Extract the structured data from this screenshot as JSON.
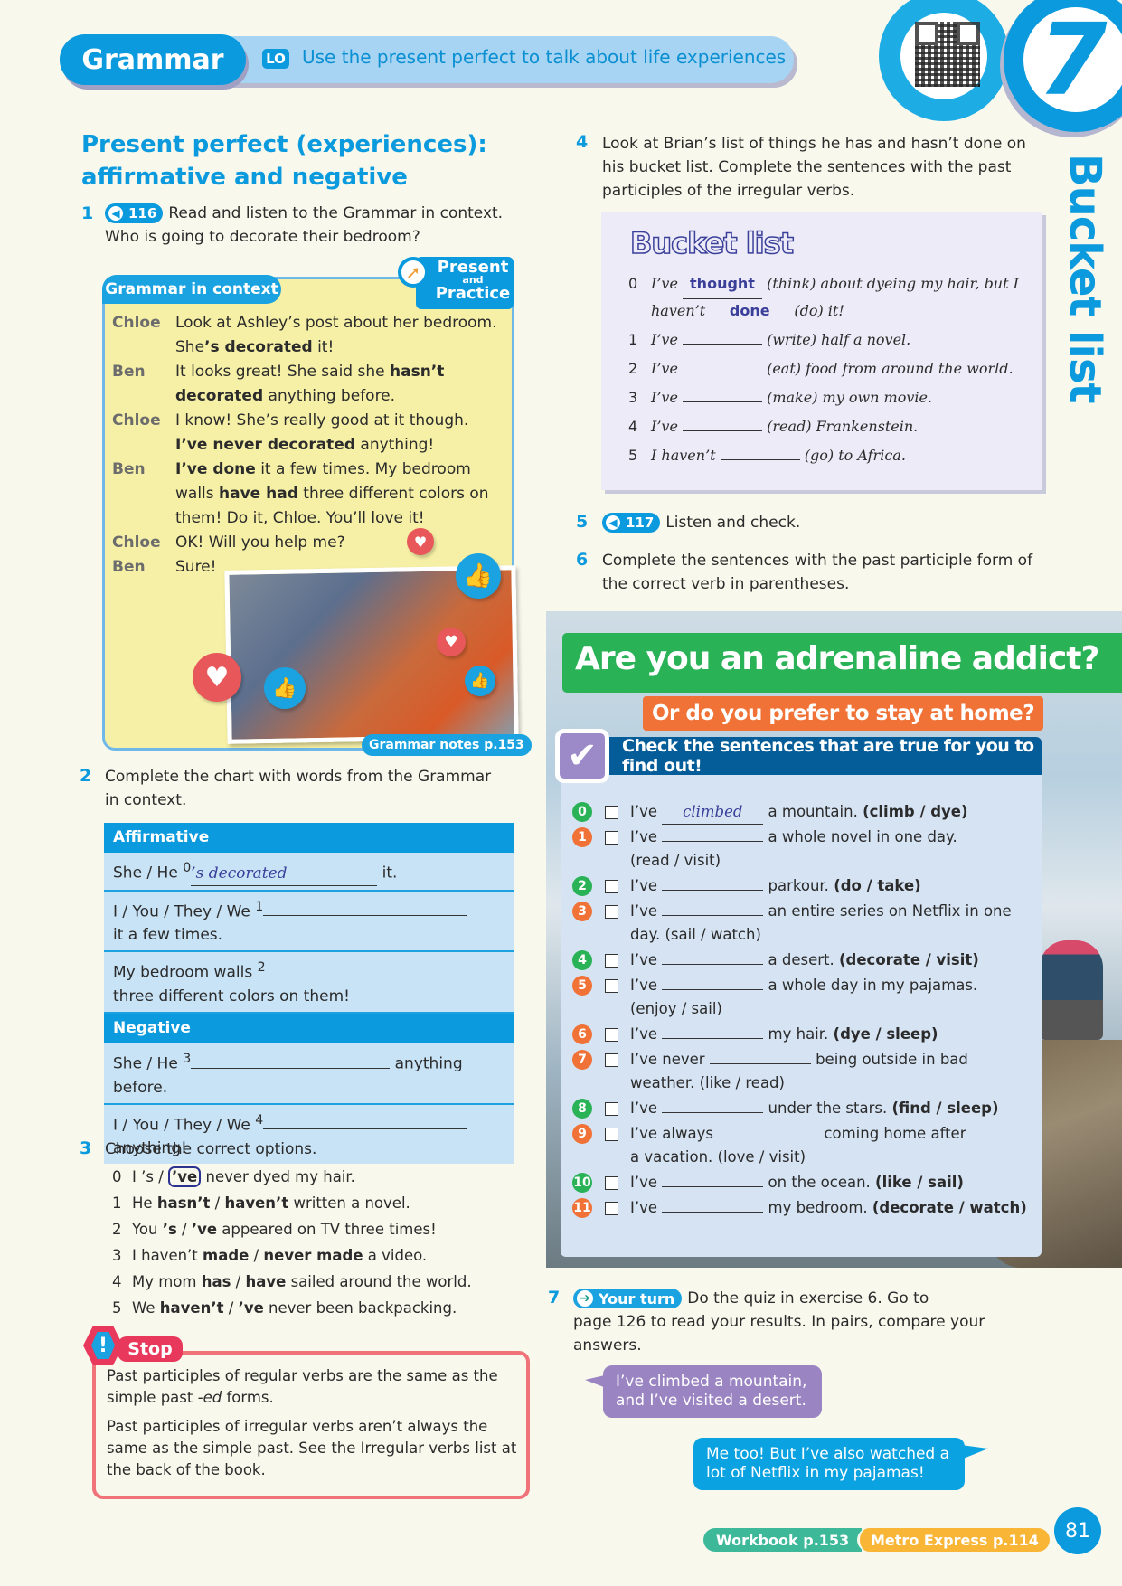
{
  "header": {
    "section": "Grammar",
    "lo_badge": "LO",
    "lo_text": "Use the present perfect to talk about life experiences",
    "unit_number": "7",
    "unit_title": "Bucket list",
    "qr_icon": "qr-code-icon"
  },
  "left": {
    "section_title_1": "Present perfect (experiences):",
    "section_title_2": "affirmative and negative",
    "ex1": {
      "num": "1",
      "audio": "116",
      "text_1": "Read and listen to the Grammar in context.",
      "text_2": "Who is going to decorate their bedroom?"
    },
    "grammar_in_context": {
      "tab": "Grammar in context",
      "badge_top": "Present",
      "badge_mid": "and",
      "badge_bottom": "Practice",
      "photo_label": "Grammar notes p.153",
      "dialogue": [
        {
          "speaker": "Chloe",
          "line1": "Look at Ashley’s post about her bedroom.",
          "line2_pre": "She",
          "line2_bold": "’s decorated",
          "line2_post": " it!"
        },
        {
          "speaker": "Ben",
          "line1_pre": "It looks great! She said she ",
          "line1_bold": "hasn’t",
          "line2_bold": "decorated",
          "line2_post": " anything before."
        },
        {
          "speaker": "Chloe",
          "line1": "I know! She’s really good at it though.",
          "line2_bold": "I’ve never decorated",
          "line2_post": " anything!"
        },
        {
          "speaker": "Ben",
          "line1_bold": "I’ve done",
          "line1_post": " it a few times. My bedroom",
          "line2_pre": "walls ",
          "line2_bold": "have had",
          "line2_post": " three different colors on",
          "line3": "them! Do it, Chloe. You’ll love it!"
        },
        {
          "speaker": "Chloe",
          "line1": "OK! Will you help me?"
        },
        {
          "speaker": "Ben",
          "line1": "Sure!"
        }
      ]
    },
    "ex2": {
      "num": "2",
      "text_1": "Complete the chart with words from the Grammar",
      "text_2": "in context.",
      "chart": {
        "affirmative_header": "Affirmative",
        "negative_header": "Negative",
        "rows": [
          {
            "pre": "She / He ",
            "sup": "0",
            "answer": "’s decorated",
            "post": " it.",
            "line2": ""
          },
          {
            "pre": "I / You / They / We ",
            "sup": "1",
            "answer": "",
            "post": "",
            "line2": "it a few times."
          },
          {
            "pre": "My bedroom walls ",
            "sup": "2",
            "answer": "",
            "post": "",
            "line2": "three different colors on them!"
          },
          {
            "pre": "She / He ",
            "sup": "3",
            "answer": "",
            "post": " anything",
            "line2": "before."
          },
          {
            "pre": "I / You / They / We ",
            "sup": "4",
            "answer": "",
            "post": "",
            "line2": "anything!"
          }
        ]
      }
    },
    "ex3": {
      "num": "3",
      "text": "Choose the correct options.",
      "items": [
        {
          "n": "0",
          "pre": "I ",
          "opt1": "’s",
          "sep": " / ",
          "opt2": "’ve",
          "post": " never dyed my hair.",
          "selected": 2
        },
        {
          "n": "1",
          "pre": "He ",
          "opt1": "hasn’t",
          "sep": " / ",
          "opt2": "haven’t",
          "post": " written a novel."
        },
        {
          "n": "2",
          "pre": "You ",
          "opt1": "’s",
          "sep": " / ",
          "opt2": "’ve",
          "post": " appeared on TV three times!"
        },
        {
          "n": "3",
          "pre": "I haven’t ",
          "opt1": "made",
          "sep": " / ",
          "opt2": "never made",
          "post": " a video."
        },
        {
          "n": "4",
          "pre": "My mom ",
          "opt1": "has",
          "sep": " / ",
          "opt2": "have",
          "post": " sailed around the world."
        },
        {
          "n": "5",
          "pre": "We ",
          "opt1": "haven’t",
          "sep": " / ",
          "opt2": "’ve",
          "post": " never been backpacking."
        }
      ]
    },
    "stop": {
      "label": "Stop",
      "icon_glyph": "!",
      "p1_pre": "Past participles of regular verbs are the same as the simple past ",
      "p1_italic": "-ed",
      "p1_post": " forms.",
      "p2": "Past participles of irregular verbs aren’t always the same as the simple past. See the Irregular verbs list at the back of the book."
    }
  },
  "right": {
    "ex4": {
      "num": "4",
      "text_1": "Look at Brian’s list of things he has and hasn’t done on",
      "text_2": "his bucket list. Complete the sentences with the past",
      "text_3": "participles of the irregular verbs.",
      "box_title": "Bucket list",
      "items": [
        {
          "n": "0",
          "pre": "I’ve ",
          "answer": "thought",
          "post": " (think) about dyeing my hair, but I"
        },
        {
          "n": "",
          "pre": "haven’t ",
          "answer": "done",
          "post": " (do) it!"
        },
        {
          "n": "1",
          "pre": "I’ve ",
          "answer": "",
          "post": " (write) half a novel."
        },
        {
          "n": "2",
          "pre": "I’ve ",
          "answer": "",
          "post": " (eat) food from around the world."
        },
        {
          "n": "3",
          "pre": "I’ve ",
          "answer": "",
          "post": " (make) my own movie."
        },
        {
          "n": "4",
          "pre": "I’ve ",
          "answer": "",
          "post": " (read) Frankenstein."
        },
        {
          "n": "5",
          "pre": "I haven’t ",
          "answer": "",
          "post": " (go) to Africa."
        }
      ]
    },
    "ex5": {
      "num": "5",
      "audio": "117",
      "text": "Listen and check."
    },
    "ex6": {
      "num": "6",
      "text_1": "Complete the sentences with the past participle form of",
      "text_2": "the correct verb in parentheses.",
      "quiz": {
        "title": "Are you an adrenaline addict?",
        "subtitle": "Or do you prefer to stay at home?",
        "instruction": "Check the sentences that are true for you to find out!",
        "check_glyph": "✔",
        "items": [
          {
            "n": "0",
            "color": "g",
            "pre": "I’ve ",
            "answer": "climbed",
            "post": " a mountain. ",
            "opts": "(climb / dye)",
            "wrap": ""
          },
          {
            "n": "1",
            "color": "o",
            "pre": "I’ve ",
            "answer": "",
            "post": " a whole novel in one day.",
            "opts": "",
            "wrap": "(read / visit)"
          },
          {
            "n": "2",
            "color": "g",
            "pre": "I’ve ",
            "answer": "",
            "post": " parkour. ",
            "opts": "(do / take)",
            "wrap": ""
          },
          {
            "n": "3",
            "color": "o",
            "pre": "I’ve ",
            "answer": "",
            "post": " an entire series on Netflix in one",
            "opts": "",
            "wrap": "day. (sail / watch)"
          },
          {
            "n": "4",
            "color": "g",
            "pre": "I’ve ",
            "answer": "",
            "post": " a desert. ",
            "opts": "(decorate / visit)",
            "wrap": ""
          },
          {
            "n": "5",
            "color": "o",
            "pre": "I’ve ",
            "answer": "",
            "post": " a whole day in my pajamas.",
            "opts": "",
            "wrap": "(enjoy / sail)"
          },
          {
            "n": "6",
            "color": "o",
            "pre": "I’ve ",
            "answer": "",
            "post": " my hair. ",
            "opts": "(dye / sleep)",
            "wrap": ""
          },
          {
            "n": "7",
            "color": "o",
            "pre": "I’ve never ",
            "answer": "",
            "post": " being outside in bad",
            "opts": "",
            "wrap": "weather. (like / read)"
          },
          {
            "n": "8",
            "color": "g",
            "pre": "I’ve ",
            "answer": "",
            "post": " under the stars. ",
            "opts": "(find / sleep)",
            "wrap": ""
          },
          {
            "n": "9",
            "color": "o",
            "pre": "I’ve always ",
            "answer": "",
            "post": " coming home after",
            "opts": "",
            "wrap": "a vacation. (love / visit)"
          },
          {
            "n": "10",
            "color": "g",
            "pre": "I’ve ",
            "answer": "",
            "post": " on the ocean. ",
            "opts": "(like / sail)",
            "wrap": ""
          },
          {
            "n": "11",
            "color": "o",
            "pre": "I’ve ",
            "answer": "",
            "post": " my bedroom. ",
            "opts": "(decorate / watch)",
            "wrap": ""
          }
        ]
      }
    },
    "ex7": {
      "num": "7",
      "badge": "Your turn",
      "text_1": "Do the quiz in exercise 6. Go to",
      "text_2": "page 126 to read your results. In pairs, compare your",
      "text_3": "answers.",
      "bubble_1": "I’ve climbed a mountain, and I’ve visited a desert.",
      "bubble_2": "Me too! But I’ve also watched a lot of Netflix in my pajamas!"
    }
  },
  "footer": {
    "workbook": "Workbook p.153",
    "metro": "Metro Express p.114",
    "page_number": "81"
  },
  "colors": {
    "brand_blue": "#0a9add",
    "quiz_green": "#29b256",
    "quiz_orange": "#f07236",
    "stop_red": "#e8395c",
    "handwriting": "#3a3f9a"
  }
}
